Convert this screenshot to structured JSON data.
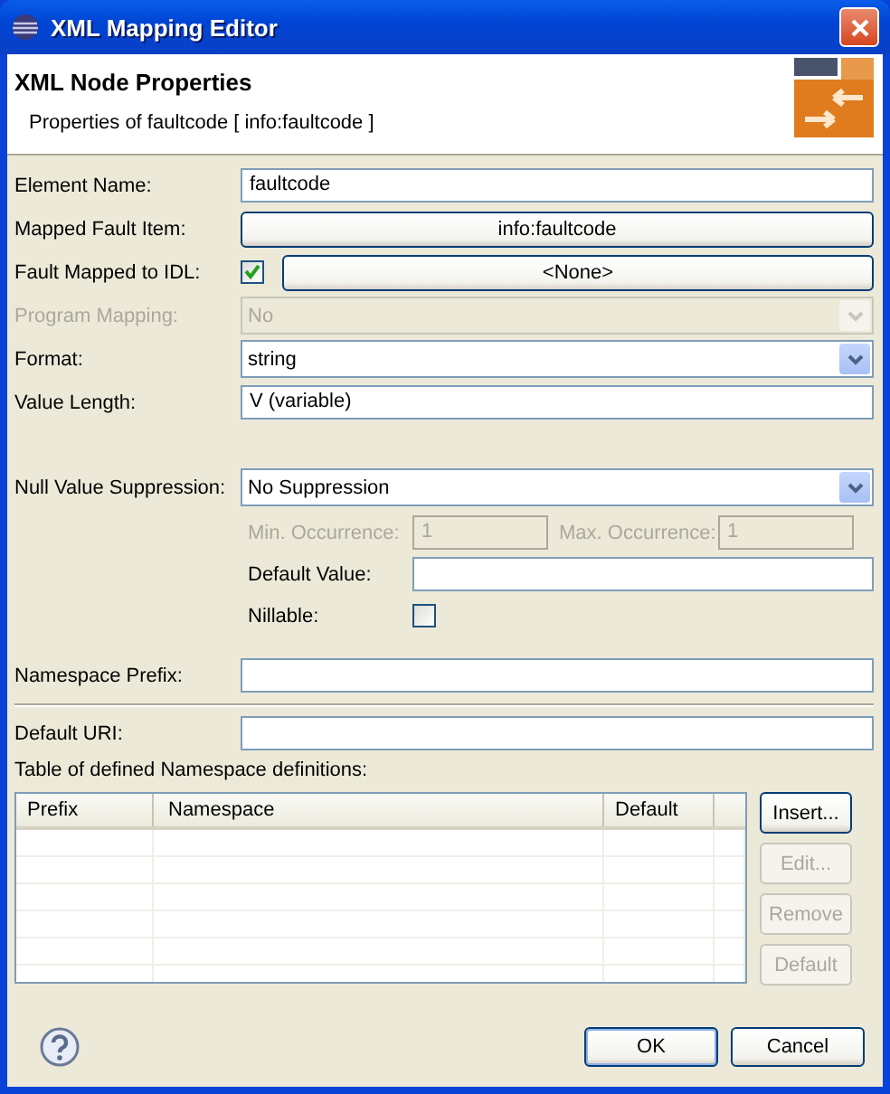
{
  "window": {
    "title": "XML Mapping Editor"
  },
  "header": {
    "title": "XML Node Properties",
    "subtitle": "Properties of faultcode [ info:faultcode ]"
  },
  "fields": [
    {
      "kind": "text",
      "label": "Element Name:",
      "value": "faultcode"
    },
    {
      "kind": "button",
      "label": "Mapped Fault Item:",
      "button": "info:faultcode"
    },
    {
      "kind": "check-button",
      "label": "Fault Mapped to IDL:",
      "checked": true,
      "button": "<None>"
    },
    {
      "kind": "combo",
      "label": "Program Mapping:",
      "value": "No",
      "disabled": true
    },
    {
      "kind": "combo",
      "label": "Format:",
      "value": "string",
      "disabled": false
    },
    {
      "kind": "text",
      "label": "Value Length:",
      "value": "V (variable)"
    }
  ],
  "suppression": {
    "label": "Null Value Suppression:",
    "value": "No Suppression",
    "occurrence": {
      "disabled": true,
      "min_label": "Min. Occurrence:",
      "min_value": "1",
      "max_label": "Max. Occurrence:",
      "max_value": "1"
    },
    "default_value": {
      "label": "Default Value:"
    },
    "nillable": {
      "label": "Nillable:",
      "checked": false
    }
  },
  "namespace_prefix": {
    "label": "Namespace Prefix:"
  },
  "default_uri": {
    "label": "Default URI:"
  },
  "namespace_table": {
    "label": "Table of defined Namespace definitions:",
    "columns": [
      "Prefix",
      "Namespace",
      "Default"
    ]
  },
  "side_buttons": [
    {
      "label": "Insert...",
      "disabled": false
    },
    {
      "label": "Edit...",
      "disabled": true
    },
    {
      "label": "Remove",
      "disabled": true
    },
    {
      "label": "Default",
      "disabled": true
    }
  ],
  "buttons": [
    {
      "label": "OK",
      "default": true
    },
    {
      "label": "Cancel",
      "default": false
    }
  ]
}
